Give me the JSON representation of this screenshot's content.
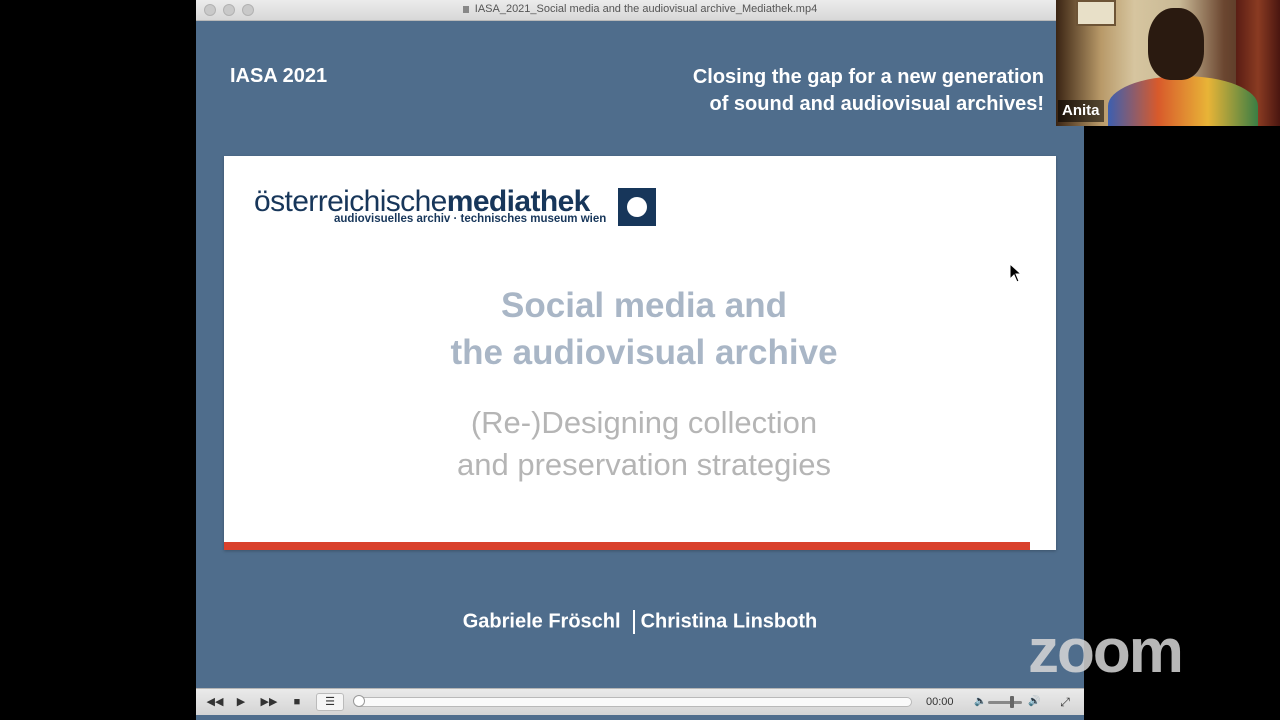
{
  "window": {
    "title": "IASA_2021_Social media and the audiovisual archive_Mediathek.mp4"
  },
  "slide": {
    "header_left": "IASA 2021",
    "header_right_line1": "Closing the gap for a new generation",
    "header_right_line2": "of sound and audiovisual archives!",
    "logo_word_light": "österreichische",
    "logo_word_bold": "mediathek",
    "logo_subtitle": "audiovisuelles archiv · technisches museum wien",
    "title_line1": "Social media and",
    "title_line2": "the audiovisual archive",
    "subtitle_line1": "(Re-)Designing collection",
    "subtitle_line2": "and preservation strategies",
    "author1": "Gabriele Fröschl",
    "author2": "Christina Linsboth",
    "colors": {
      "background": "#4f6d8c",
      "title_text": "#a9b6c6",
      "accent_bar": "#d9412c",
      "logo_navy": "#17365a"
    }
  },
  "player": {
    "current_time": "00:00",
    "progress": 0,
    "volume_fraction": 0.65,
    "icons": {
      "rewind": "◀◀",
      "play": "▶",
      "fast_forward": "▶▶",
      "stop": "■",
      "playlist": "☰",
      "volume_low": "🔈",
      "volume_high": "🔊",
      "fullscreen": "⤢"
    }
  },
  "participant": {
    "name": "Anita"
  },
  "watermark": {
    "text": "zoom"
  }
}
